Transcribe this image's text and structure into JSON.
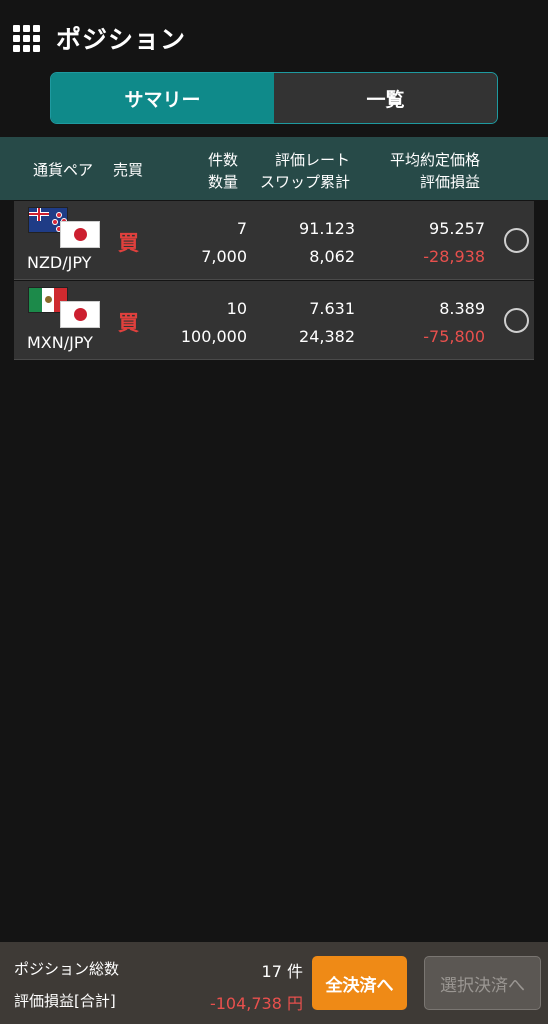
{
  "header": {
    "title": "ポジション",
    "menu_icon": "grid-menu-icon"
  },
  "tabs": [
    {
      "label": "サマリー",
      "active": true
    },
    {
      "label": "一覧",
      "active": false
    }
  ],
  "table": {
    "headers": {
      "pair": "通貨ペア",
      "side": "売買",
      "count": "件数",
      "quantity": "数量",
      "rate": "評価レート",
      "swap": "スワップ累計",
      "avg_price": "平均約定価格",
      "pl": "評価損益"
    },
    "rows": [
      {
        "pair": "NZD/JPY",
        "side": "買",
        "count": "7",
        "quantity": "7,000",
        "rate": "91.123",
        "swap": "8,062",
        "avg_price": "95.257",
        "pl": "-28,938"
      },
      {
        "pair": "MXN/JPY",
        "side": "買",
        "count": "10",
        "quantity": "100,000",
        "rate": "7.631",
        "swap": "24,382",
        "avg_price": "8.389",
        "pl": "-75,800"
      }
    ]
  },
  "footer": {
    "total_label": "ポジション総数",
    "total_value": "17 件",
    "pl_label": "評価損益[合計]",
    "pl_value": "-104,738 円",
    "close_all_label": "全決済へ",
    "close_selected_label": "選択決済へ"
  },
  "colors": {
    "accent": "#0f8a8a",
    "header_row": "#274a48",
    "loss": "#e8504d",
    "buy": "#e0403d",
    "close_all": "#ef8a16"
  }
}
